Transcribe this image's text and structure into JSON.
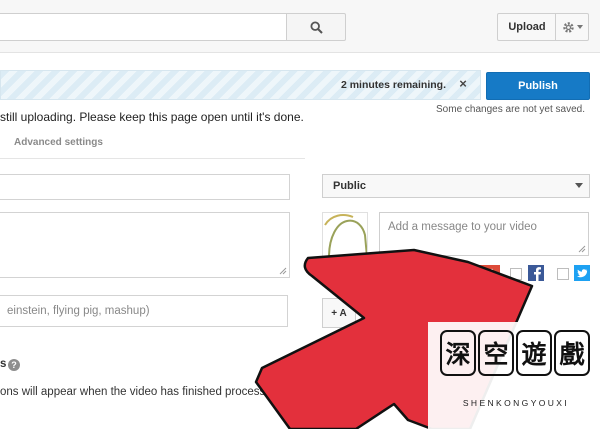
{
  "header": {
    "upload_label": "Upload"
  },
  "upload_status": {
    "time_remaining": "2 minutes remaining.",
    "close_symbol": "×",
    "publish_label": "Publish",
    "save_note": "Some changes are not yet saved.",
    "uploading_message": "still uploading. Please keep this page open until it's done."
  },
  "tabs": {
    "advanced_settings": "Advanced settings"
  },
  "form": {
    "tags_placeholder": "einstein, flying pig, mashup)",
    "add_label": "+ A",
    "thumbnails_label": "s",
    "help_symbol": "?",
    "thumbnails_note": "ons will appear when the video has finished processing."
  },
  "sidebar": {
    "privacy_value": "Public",
    "message_placeholder": "Add a message to your video",
    "gplus_label": "g+"
  },
  "watermark": {
    "chars": [
      "深",
      "空",
      "遊",
      "戲"
    ],
    "subtitle": "SHENKONGYOUXI"
  },
  "colors": {
    "publish_blue": "#167ac6",
    "arrow_red": "#e3303c",
    "facebook_blue": "#3b5998",
    "twitter_blue": "#1da1f2",
    "gplus_red": "#dd4b39"
  }
}
